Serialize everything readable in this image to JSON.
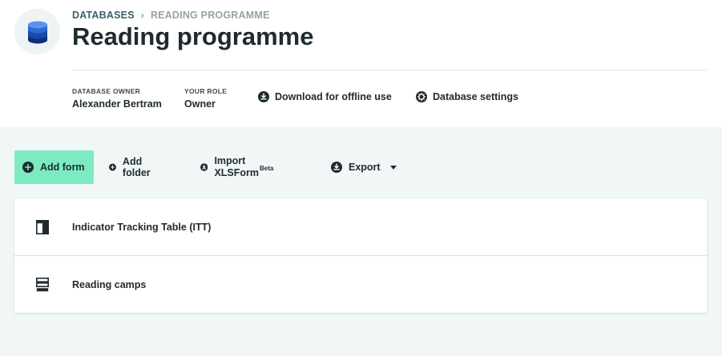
{
  "breadcrumb": {
    "root": "DATABASES",
    "current": "READING PROGRAMME"
  },
  "page": {
    "title": "Reading programme"
  },
  "meta": {
    "owner_label": "DATABASE OWNER",
    "owner_value": "Alexander Bertram",
    "role_label": "YOUR ROLE",
    "role_value": "Owner"
  },
  "header_actions": {
    "download": "Download for offline use",
    "settings": "Database settings"
  },
  "toolbar": {
    "add_form": "Add form",
    "add_folder": "Add folder",
    "import_xlsform": "Import XLSForm",
    "import_badge": "Beta",
    "export": "Export"
  },
  "forms": [
    {
      "label": "Indicator Tracking Table (ITT)",
      "icon": "table-icon"
    },
    {
      "label": "Reading camps",
      "icon": "form-icon"
    }
  ],
  "colors": {
    "accent": "#7debc1",
    "background": "#f1f6f6",
    "database_icon": "#1d5fbf"
  }
}
